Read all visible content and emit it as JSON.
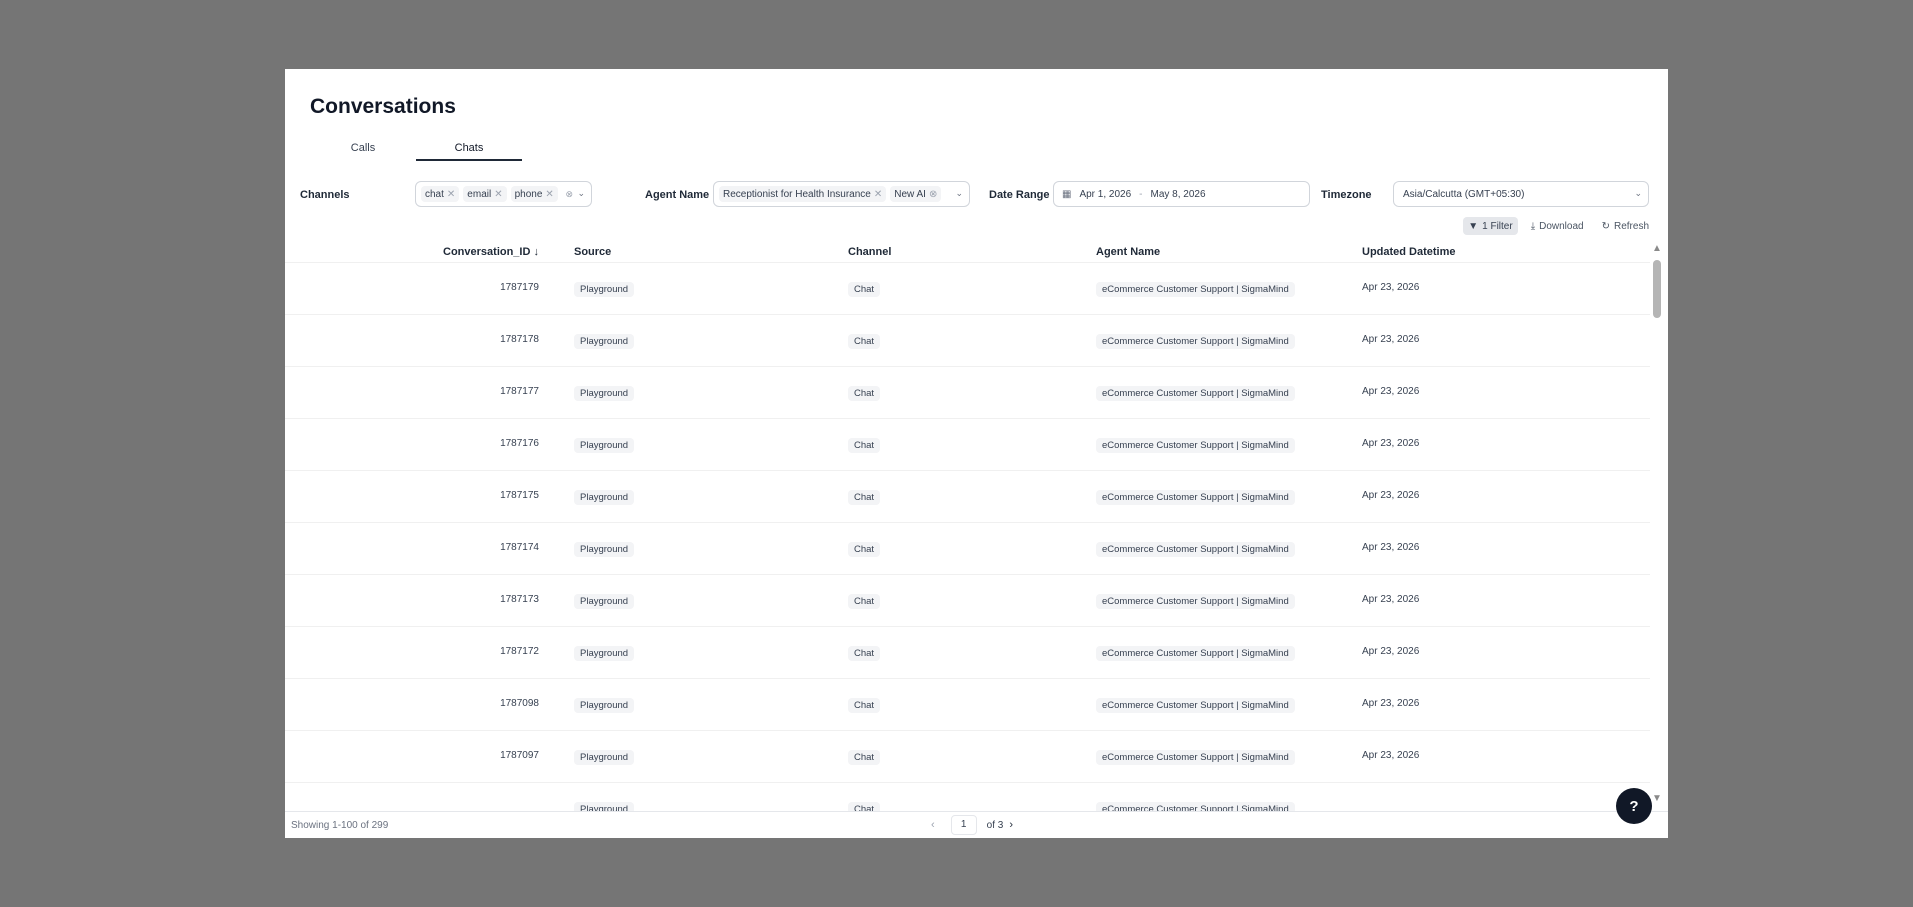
{
  "page": {
    "title": "Conversations"
  },
  "tabs": [
    {
      "label": "Calls"
    },
    {
      "label": "Chats"
    }
  ],
  "filters": {
    "channels": {
      "label": "Channels",
      "chips": [
        "chat",
        "email",
        "phone"
      ]
    },
    "agent": {
      "label": "Agent Name",
      "chips": [
        "Receptionist for Health Insurance",
        "New AI"
      ]
    },
    "date": {
      "label": "Date Range",
      "start": "Apr 1, 2026",
      "sep": "-",
      "end": "May 8, 2026"
    },
    "timezone": {
      "label": "Timezone",
      "value": "Asia/Calcutta (GMT+05:30)"
    }
  },
  "toolbar": {
    "filter_label": "1 Filter",
    "download_label": "Download",
    "refresh_label": "Refresh"
  },
  "table": {
    "columns": {
      "id": "Conversation_ID",
      "source": "Source",
      "channel": "Channel",
      "agent": "Agent Name",
      "updated": "Updated Datetime"
    },
    "rows": [
      {
        "id": "1787179",
        "source": "Playground",
        "channel": "Chat",
        "agent": "eCommerce Customer Support | SigmaMind",
        "updated": "Apr 23, 2026"
      },
      {
        "id": "1787178",
        "source": "Playground",
        "channel": "Chat",
        "agent": "eCommerce Customer Support | SigmaMind",
        "updated": "Apr 23, 2026"
      },
      {
        "id": "1787177",
        "source": "Playground",
        "channel": "Chat",
        "agent": "eCommerce Customer Support | SigmaMind",
        "updated": "Apr 23, 2026"
      },
      {
        "id": "1787176",
        "source": "Playground",
        "channel": "Chat",
        "agent": "eCommerce Customer Support | SigmaMind",
        "updated": "Apr 23, 2026"
      },
      {
        "id": "1787175",
        "source": "Playground",
        "channel": "Chat",
        "agent": "eCommerce Customer Support | SigmaMind",
        "updated": "Apr 23, 2026"
      },
      {
        "id": "1787174",
        "source": "Playground",
        "channel": "Chat",
        "agent": "eCommerce Customer Support | SigmaMind",
        "updated": "Apr 23, 2026"
      },
      {
        "id": "1787173",
        "source": "Playground",
        "channel": "Chat",
        "agent": "eCommerce Customer Support | SigmaMind",
        "updated": "Apr 23, 2026"
      },
      {
        "id": "1787172",
        "source": "Playground",
        "channel": "Chat",
        "agent": "eCommerce Customer Support | SigmaMind",
        "updated": "Apr 23, 2026"
      },
      {
        "id": "1787098",
        "source": "Playground",
        "channel": "Chat",
        "agent": "eCommerce Customer Support | SigmaMind",
        "updated": "Apr 23, 2026"
      },
      {
        "id": "1787097",
        "source": "Playground",
        "channel": "Chat",
        "agent": "eCommerce Customer Support | SigmaMind",
        "updated": "Apr 23, 2026"
      },
      {
        "id": "",
        "source": "Playground",
        "channel": "Chat",
        "agent": "eCommerce Customer Support | SigmaMind",
        "updated": ""
      }
    ]
  },
  "footer": {
    "showing": "Showing 1-100 of 299",
    "page": "1",
    "of": "of 3"
  },
  "colors": {
    "accent": "#1f2937",
    "overlay": "#757575"
  }
}
